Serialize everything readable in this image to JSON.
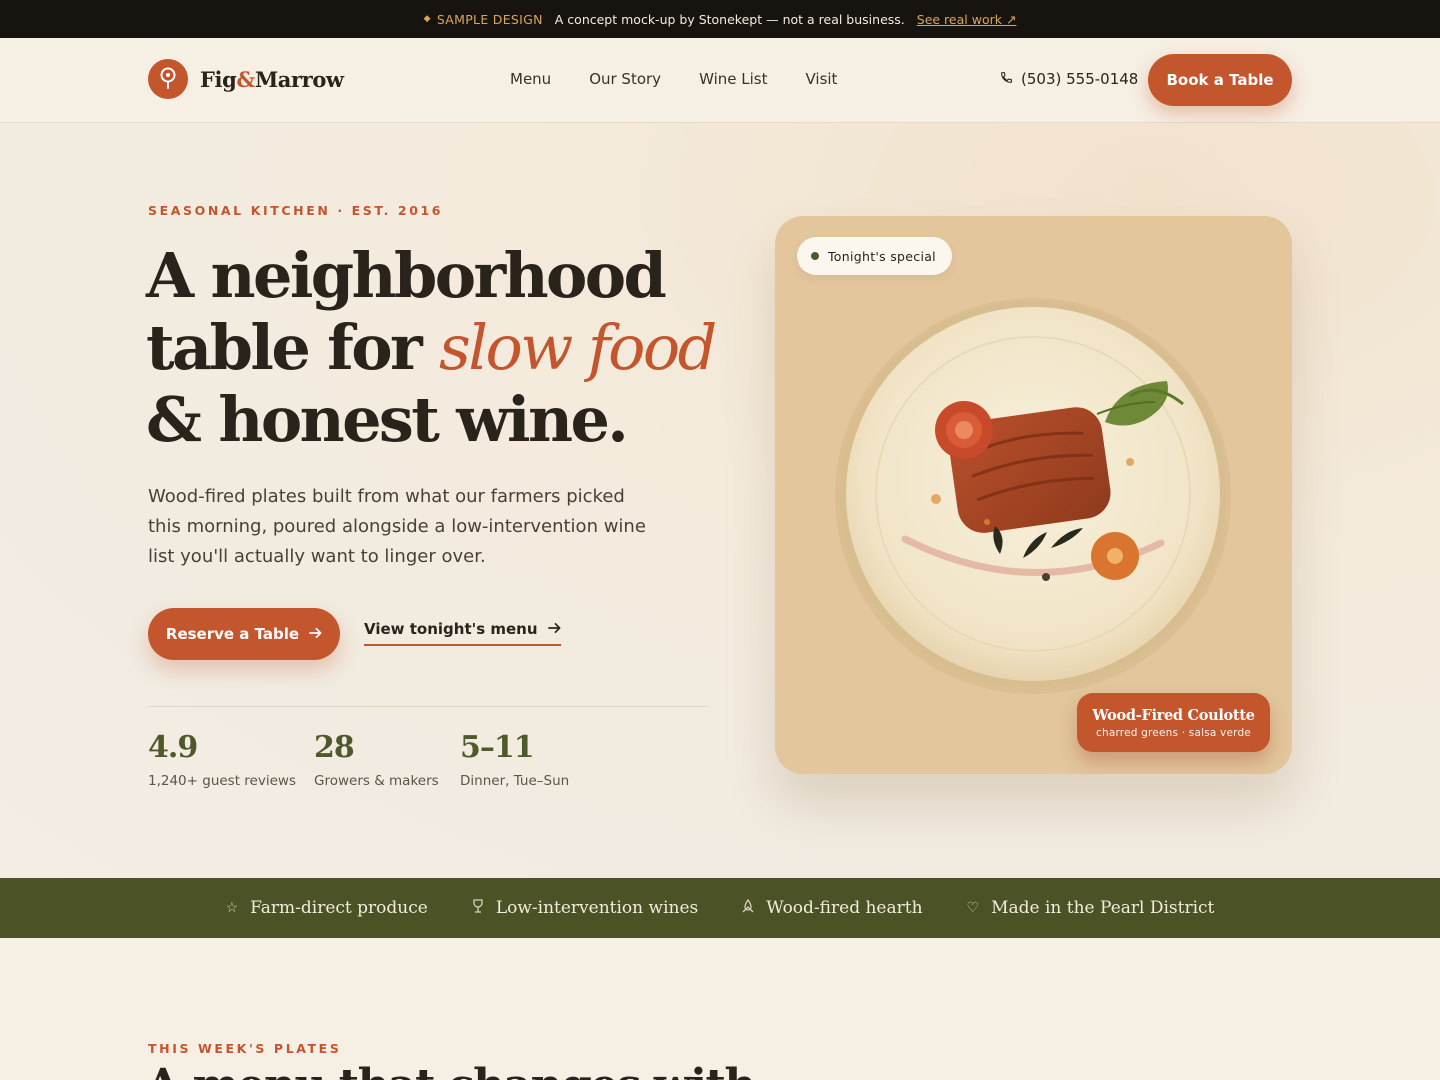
{
  "banner": {
    "tag": "SAMPLE DESIGN",
    "text": "A concept mock-up by Stonekept — not a real business.",
    "link": "See real work ↗"
  },
  "brand": {
    "name_part1": "Fig",
    "amp": "&",
    "name_part2": "Marrow"
  },
  "nav": {
    "items": [
      "Menu",
      "Our Story",
      "Wine List",
      "Visit"
    ]
  },
  "header": {
    "phone": "(503) 555-0148",
    "book_label": "Book a Table"
  },
  "hero": {
    "eyebrow": "SEASONAL KITCHEN · EST. 2016",
    "headline_line1": "A neighborhood",
    "headline_line2_a": "table for ",
    "headline_line2_accent": "slow food",
    "headline_line3": "& honest wine.",
    "lede": "Wood-fired plates built from what our farmers picked this morning, poured alongside a low-intervention wine list you'll actually want to linger over.",
    "reserve_label": "Reserve a Table",
    "menu_link_label": "View tonight's menu",
    "stats": [
      {
        "value": "4.9",
        "label": "1,240+ guest reviews"
      },
      {
        "value": "28",
        "label": "Growers & makers"
      },
      {
        "value": "5–11",
        "label": "Dinner, Tue–Sun"
      }
    ]
  },
  "special_card": {
    "chip": "Tonight's special",
    "dish_name": "Wood-Fired Coulotte",
    "dish_sub": "charred greens · salsa verde"
  },
  "features": [
    {
      "icon": "star-icon",
      "label": "Farm-direct produce"
    },
    {
      "icon": "wine-glass-icon",
      "label": "Low-intervention wines"
    },
    {
      "icon": "flame-icon",
      "label": "Wood-fired hearth"
    },
    {
      "icon": "heart-icon",
      "label": "Made in the Pearl District"
    }
  ],
  "section": {
    "eyebrow": "THIS WEEK'S PLATES",
    "heading": "A menu that changes with"
  },
  "colors": {
    "accent": "#c4562e",
    "olive": "#4a5226",
    "cream": "#f6efe4",
    "ink": "#2a231c",
    "card": "#e3c69c"
  }
}
